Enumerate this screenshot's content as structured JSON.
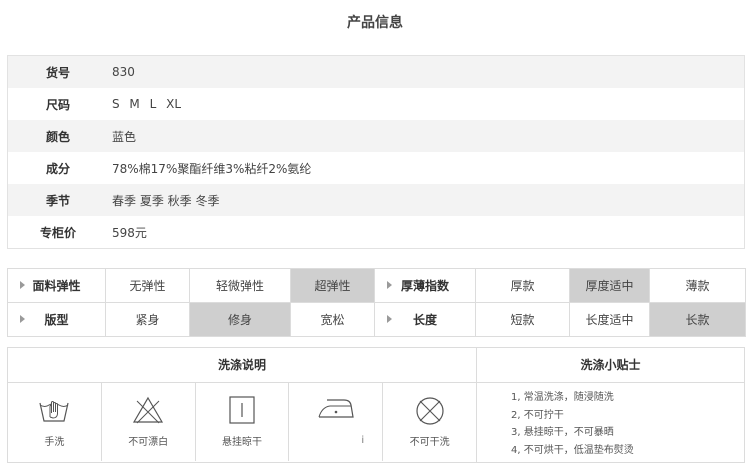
{
  "title": "产品信息",
  "info": [
    {
      "key": "货号",
      "value": "830"
    },
    {
      "key": "尺码",
      "value": "S M L XL"
    },
    {
      "key": "颜色",
      "value": "蓝色"
    },
    {
      "key": "成分",
      "value": "78%棉17%聚酯纤维3%粘纤2%氨纶"
    },
    {
      "key": "季节",
      "value": "春季 夏季 秋季 冬季"
    },
    {
      "key": "专柜价",
      "value": "598元"
    }
  ],
  "attributes": {
    "row1": {
      "elasticity_label": "面料弹性",
      "elasticity_options": [
        "无弹性",
        "轻微弹性",
        "超弹性"
      ],
      "elasticity_selected": "超弹性",
      "thickness_label": "厚薄指数",
      "thickness_options": [
        "厚款",
        "厚度适中",
        "薄款"
      ],
      "thickness_selected": "厚度适中"
    },
    "row2": {
      "fit_label": "版型",
      "fit_options": [
        "紧身",
        "修身",
        "宽松"
      ],
      "fit_selected": "修身",
      "length_label": "长度",
      "length_options": [
        "短款",
        "长度适中",
        "长款"
      ],
      "length_selected": "长款"
    }
  },
  "care": {
    "wash_title": "洗涤说明",
    "tips_title": "洗涤小贴士",
    "icons": [
      {
        "icon": "hand-wash-icon",
        "label": "手洗"
      },
      {
        "icon": "no-bleach-icon",
        "label": "不可漂白"
      },
      {
        "icon": "hang-dry-icon",
        "label": "悬挂晾干"
      },
      {
        "icon": "iron-icon",
        "label": "",
        "mark": "i"
      },
      {
        "icon": "no-dry-clean-icon",
        "label": "不可干洗"
      }
    ],
    "tips": [
      "1, 常温洗涤，随浸随洗",
      "2, 不可拧干",
      "3, 悬挂晾干，不可暴晒",
      "4, 不可烘干，低温垫布熨烫"
    ]
  }
}
